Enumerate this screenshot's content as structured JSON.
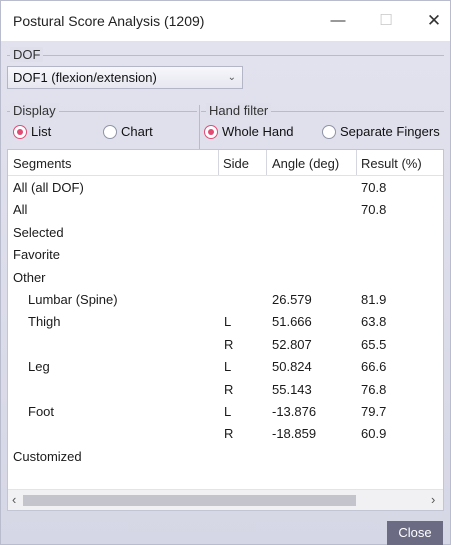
{
  "window": {
    "title": "Postural Score Analysis (1209)",
    "minimize_glyph": "—",
    "maximize_glyph": "☐",
    "close_glyph": "✕"
  },
  "dof": {
    "group_label": "DOF",
    "selected": "DOF1 (flexion/extension)"
  },
  "display": {
    "group_label": "Display",
    "options": [
      "List",
      "Chart"
    ],
    "selected": "List"
  },
  "hand_filter": {
    "group_label": "Hand filter",
    "options": [
      "Whole Hand",
      "Separate Fingers"
    ],
    "selected": "Whole Hand"
  },
  "table": {
    "headers": [
      "Segments",
      "Side",
      "Angle (deg)",
      "Result (%)"
    ],
    "rows": [
      {
        "segment": "All (all DOF)",
        "indent": false,
        "side": "",
        "angle": "",
        "result": "70.8"
      },
      {
        "segment": "All",
        "indent": false,
        "side": "",
        "angle": "",
        "result": "70.8"
      },
      {
        "segment": "Selected",
        "indent": false,
        "side": "",
        "angle": "",
        "result": ""
      },
      {
        "segment": "Favorite",
        "indent": false,
        "side": "",
        "angle": "",
        "result": ""
      },
      {
        "segment": "Other",
        "indent": false,
        "side": "",
        "angle": "",
        "result": ""
      },
      {
        "segment": "Lumbar (Spine)",
        "indent": true,
        "side": "",
        "angle": "26.579",
        "result": "81.9"
      },
      {
        "segment": "Thigh",
        "indent": true,
        "side": "L",
        "angle": "51.666",
        "result": "63.8"
      },
      {
        "segment": "",
        "indent": true,
        "side": "R",
        "angle": "52.807",
        "result": "65.5"
      },
      {
        "segment": "Leg",
        "indent": true,
        "side": "L",
        "angle": "50.824",
        "result": "66.6"
      },
      {
        "segment": "",
        "indent": true,
        "side": "R",
        "angle": "55.143",
        "result": "76.8"
      },
      {
        "segment": "Foot",
        "indent": true,
        "side": "L",
        "angle": "-13.876",
        "result": "79.7"
      },
      {
        "segment": "",
        "indent": true,
        "side": "R",
        "angle": "-18.859",
        "result": "60.9"
      },
      {
        "segment": "Customized",
        "indent": false,
        "side": "",
        "angle": "",
        "result": ""
      }
    ]
  },
  "scrollbar": {
    "left_arrow": "‹",
    "right_arrow": "›"
  },
  "footer": {
    "close_label": "Close"
  },
  "colors": {
    "accent_radio": "#e24b74",
    "close_button": "#6b6c83"
  }
}
